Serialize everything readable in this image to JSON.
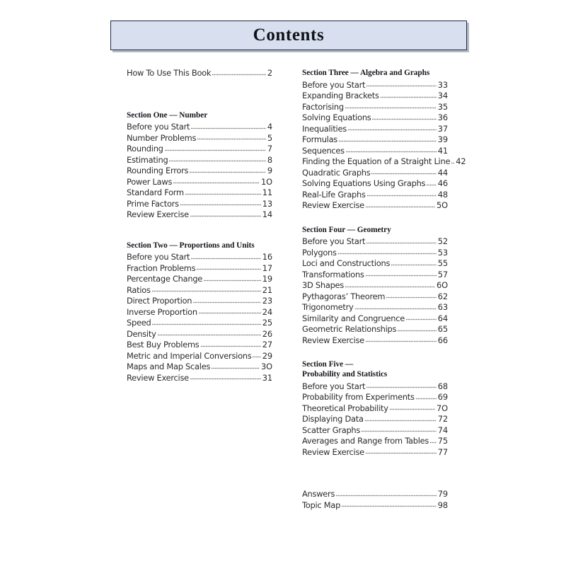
{
  "header": {
    "title": "Contents",
    "banner_fill": "#d8e0f0",
    "banner_border": "#1f2a44"
  },
  "columns": {
    "left": [
      {
        "type": "entries",
        "heading": null,
        "entries": [
          {
            "title": "How To Use This Book",
            "page": "2"
          }
        ]
      },
      {
        "type": "entries",
        "heading": {
          "line1": "Section One — Number",
          "line2": null
        },
        "entries": [
          {
            "title": "Before you Start",
            "page": "4"
          },
          {
            "title": "Number Problems",
            "page": "5"
          },
          {
            "title": "Rounding",
            "page": "7"
          },
          {
            "title": "Estimating",
            "page": "8"
          },
          {
            "title": "Rounding Errors",
            "page": "9"
          },
          {
            "title": "Power Laws",
            "page": "1O"
          },
          {
            "title": "Standard Form",
            "page": "11"
          },
          {
            "title": "Prime Factors",
            "page": "13"
          },
          {
            "title": "Review Exercise",
            "page": "14"
          }
        ]
      },
      {
        "type": "entries",
        "heading": {
          "line1": "Section Two — Proportions and Units",
          "line2": null
        },
        "entries": [
          {
            "title": "Before you Start",
            "page": "16"
          },
          {
            "title": "Fraction Problems",
            "page": "17"
          },
          {
            "title": "Percentage Change",
            "page": "19"
          },
          {
            "title": "Ratios",
            "page": "21"
          },
          {
            "title": "Direct Proportion",
            "page": "23"
          },
          {
            "title": "Inverse Proportion",
            "page": "24"
          },
          {
            "title": "Speed",
            "page": "25"
          },
          {
            "title": "Density",
            "page": "26"
          },
          {
            "title": "Best Buy Problems",
            "page": "27"
          },
          {
            "title": "Metric and Imperial Conversions",
            "page": "29"
          },
          {
            "title": "Maps and Map Scales",
            "page": "3O"
          },
          {
            "title": "Review Exercise",
            "page": "31"
          }
        ]
      }
    ],
    "right": [
      {
        "type": "entries",
        "heading": {
          "line1": "Section Three — Algebra and Graphs",
          "line2": null
        },
        "entries": [
          {
            "title": "Before you Start",
            "page": "33"
          },
          {
            "title": "Expanding Brackets",
            "page": "34"
          },
          {
            "title": "Factorising",
            "page": "35"
          },
          {
            "title": "Solving Equations",
            "page": "36"
          },
          {
            "title": "Inequalities",
            "page": "37"
          },
          {
            "title": "Formulas",
            "page": "39"
          },
          {
            "title": "Sequences",
            "page": "41"
          },
          {
            "title": "Finding the Equation of a Straight Line",
            "page": "42"
          },
          {
            "title": "Quadratic Graphs",
            "page": "44"
          },
          {
            "title": "Solving Equations Using Graphs",
            "page": "46"
          },
          {
            "title": "Real-Life Graphs",
            "page": "48"
          },
          {
            "title": "Review Exercise",
            "page": "5O"
          }
        ]
      },
      {
        "type": "entries",
        "heading": {
          "line1": "Section Four — Geometry",
          "line2": null
        },
        "entries": [
          {
            "title": "Before you Start",
            "page": "52"
          },
          {
            "title": "Polygons",
            "page": "53"
          },
          {
            "title": "Loci and Constructions",
            "page": "55"
          },
          {
            "title": "Transformations",
            "page": "57"
          },
          {
            "title": "3D Shapes",
            "page": "6O"
          },
          {
            "title": "Pythagoras’ Theorem",
            "page": "62"
          },
          {
            "title": "Trigonometry",
            "page": "63"
          },
          {
            "title": "Similarity and Congruence",
            "page": "64"
          },
          {
            "title": "Geometric Relationships",
            "page": "65"
          },
          {
            "title": "Review Exercise",
            "page": "66"
          }
        ]
      },
      {
        "type": "entries",
        "heading": {
          "line1": "Section Five —",
          "line2": "Probability and Statistics"
        },
        "entries": [
          {
            "title": "Before you Start",
            "page": "68"
          },
          {
            "title": "Probability from Experiments",
            "page": "69"
          },
          {
            "title": "Theoretical Probability",
            "page": "7O"
          },
          {
            "title": "Displaying Data",
            "page": "72"
          },
          {
            "title": "Scatter Graphs",
            "page": "74"
          },
          {
            "title": "Averages and Range from Tables",
            "page": "75"
          },
          {
            "title": "Review Exercise",
            "page": "77"
          }
        ]
      },
      {
        "type": "entries",
        "heading": null,
        "entries": [
          {
            "title": "Answers",
            "page": "79"
          },
          {
            "title": "Topic Map",
            "page": "98"
          }
        ]
      }
    ]
  }
}
